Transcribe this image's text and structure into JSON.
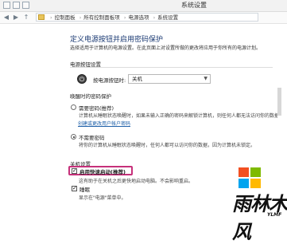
{
  "window": {
    "title": "系统设置"
  },
  "breadcrumb": [
    "控制面板",
    "所有控制面板项",
    "电源选项",
    "系统设置"
  ],
  "page": {
    "title": "定义电源按钮并启用密码保护",
    "description": "选择适用于计算机的电源设置。在此页面上对设置所做的更改将应用于你所有的电源计划。"
  },
  "power_button": {
    "section_title": "电源按钮设置",
    "label": "按电源按钮时:",
    "selected": "关机"
  },
  "wake_password": {
    "section_title": "唤醒时的密码保护",
    "options": [
      {
        "label": "需要密码(推荐)",
        "desc": "计算机从睡眠状态唤醒时，如果未输入正确的密码来解锁计算机，则任何人都无法访问你的数据。",
        "checked": false
      },
      {
        "label": "不需要密码",
        "desc": "将你的计算机从睡眠状态唤醒时，任何人都可以访问你的数据，因为计算机未锁定。",
        "checked": true
      }
    ],
    "link": "创建或更改用户帐户密码"
  },
  "shutdown": {
    "section_title": "关机设置",
    "fast_startup": {
      "label": "启用快速启动(推荐)",
      "desc": "这有助于在关机之后更快地启动电脑。不会影响重启。",
      "checked": true
    },
    "sleep": {
      "label": "睡眠",
      "desc": "显示在\"电源\"菜单中。",
      "checked": true
    }
  },
  "watermark": {
    "title": "雨林木风",
    "subtitle": "YLMF",
    "colors": [
      "#f25022",
      "#7fba00",
      "#00a4ef",
      "#ffb900"
    ]
  }
}
